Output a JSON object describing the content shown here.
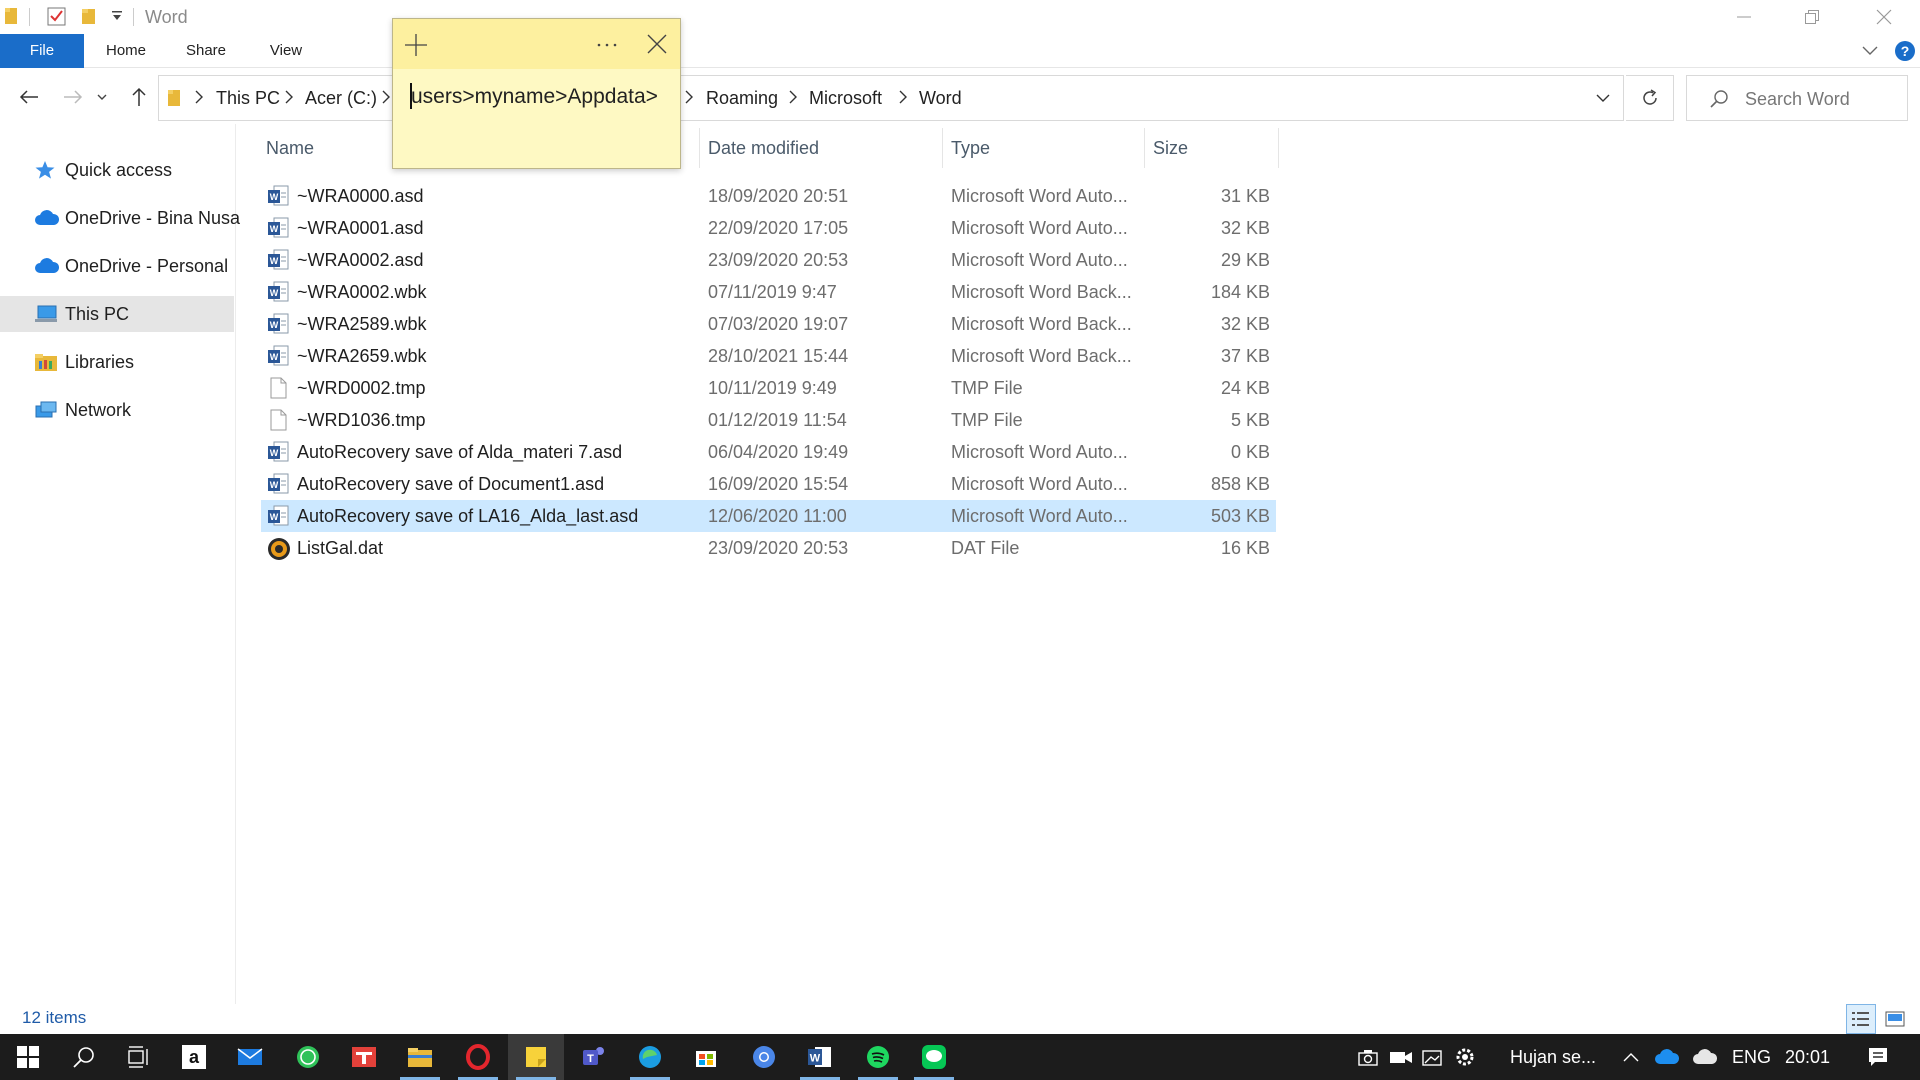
{
  "window": {
    "title": "Word"
  },
  "ribbon": {
    "tabs": [
      {
        "label": "File"
      },
      {
        "label": "Home"
      },
      {
        "label": "Share"
      },
      {
        "label": "View"
      }
    ]
  },
  "address": {
    "crumbs": [
      "This PC",
      "Acer (C:)",
      "Roaming",
      "Microsoft",
      "Word"
    ],
    "search_placeholder": "Search Word"
  },
  "nav": {
    "items": [
      {
        "label": "Quick access",
        "icon": "star-icon"
      },
      {
        "label": "OneDrive - Bina Nusa",
        "icon": "cloud-icon"
      },
      {
        "label": "OneDrive - Personal",
        "icon": "cloud-icon"
      },
      {
        "label": "This PC",
        "icon": "computer-icon",
        "selected": true
      },
      {
        "label": "Libraries",
        "icon": "libraries-icon"
      },
      {
        "label": "Network",
        "icon": "network-icon"
      }
    ]
  },
  "columns": {
    "name": "Name",
    "date": "Date modified",
    "type": "Type",
    "size": "Size"
  },
  "files": [
    {
      "name": "~WRA0000.asd",
      "date": "18/09/2020 20:51",
      "type": "Microsoft Word Auto...",
      "size": "31 KB",
      "icon": "word-doc-icon"
    },
    {
      "name": "~WRA0001.asd",
      "date": "22/09/2020 17:05",
      "type": "Microsoft Word Auto...",
      "size": "32 KB",
      "icon": "word-doc-icon"
    },
    {
      "name": "~WRA0002.asd",
      "date": "23/09/2020 20:53",
      "type": "Microsoft Word Auto...",
      "size": "29 KB",
      "icon": "word-doc-icon"
    },
    {
      "name": "~WRA0002.wbk",
      "date": "07/11/2019 9:47",
      "type": "Microsoft Word Back...",
      "size": "184 KB",
      "icon": "word-doc-icon"
    },
    {
      "name": "~WRA2589.wbk",
      "date": "07/03/2020 19:07",
      "type": "Microsoft Word Back...",
      "size": "32 KB",
      "icon": "word-doc-icon"
    },
    {
      "name": "~WRA2659.wbk",
      "date": "28/10/2021 15:44",
      "type": "Microsoft Word Back...",
      "size": "37 KB",
      "icon": "word-doc-icon"
    },
    {
      "name": "~WRD0002.tmp",
      "date": "10/11/2019 9:49",
      "type": "TMP File",
      "size": "24 KB",
      "icon": "blank-file-icon"
    },
    {
      "name": "~WRD1036.tmp",
      "date": "01/12/2019 11:54",
      "type": "TMP File",
      "size": "5 KB",
      "icon": "blank-file-icon"
    },
    {
      "name": "AutoRecovery save of Alda_materi 7.asd",
      "date": "06/04/2020 19:49",
      "type": "Microsoft Word Auto...",
      "size": "0 KB",
      "icon": "word-doc-icon"
    },
    {
      "name": "AutoRecovery save of Document1.asd",
      "date": "16/09/2020 15:54",
      "type": "Microsoft Word Auto...",
      "size": "858 KB",
      "icon": "word-doc-icon"
    },
    {
      "name": "AutoRecovery save of LA16_Alda_last.asd",
      "date": "12/06/2020 11:00",
      "type": "Microsoft Word Auto...",
      "size": "503 KB",
      "icon": "word-doc-icon",
      "selected": true
    },
    {
      "name": "ListGal.dat",
      "date": "23/09/2020 20:53",
      "type": "DAT File",
      "size": "16 KB",
      "icon": "dat-file-icon"
    }
  ],
  "sticky_note": {
    "text": "users>myname>Appdata>"
  },
  "status": {
    "item_count": "12 items"
  },
  "taskbar": {
    "weather_text": "Hujan se...",
    "language": "ENG",
    "time": "20:01"
  },
  "colors": {
    "accent": "#1a6dc9",
    "selection": "#cce8ff",
    "sticky": "#fef9c3",
    "taskbar": "#1c1c1c"
  }
}
